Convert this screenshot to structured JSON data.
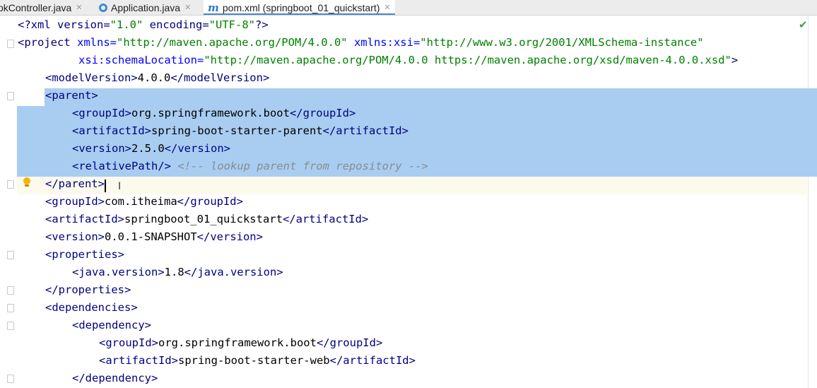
{
  "tabs": [
    {
      "label": "okController.java",
      "icon": "java-icon",
      "active": false
    },
    {
      "label": "Application.java",
      "icon": "java-icon",
      "active": false
    },
    {
      "label": "pom.xml (springboot_01_quickstart)",
      "icon": "maven-icon",
      "active": true
    }
  ],
  "editor": {
    "status_icon": "check-icon",
    "code": {
      "l1": {
        "a": "<?xml version=",
        "b": "\"1.0\"",
        "c": " encoding=",
        "d": "\"UTF-8\"",
        "e": "?>"
      },
      "l2": {
        "a": "<project ",
        "b": "xmlns=",
        "c": "\"http://maven.apache.org/POM/4.0.0\"",
        "d": " xmlns:xsi=",
        "e": "\"http://www.w3.org/2001/XMLSchema-instance\""
      },
      "l3": {
        "a": "xsi:schemaLocation=",
        "b": "\"http://maven.apache.org/POM/4.0.0 https://maven.apache.org/xsd/maven-4.0.0.xsd\"",
        "c": ">"
      },
      "l4": {
        "open": "<modelVersion>",
        "text": "4.0.0",
        "close": "</modelVersion>"
      },
      "l5": {
        "open": "<parent>"
      },
      "l6": {
        "open": "<groupId>",
        "text": "org.springframework.boot",
        "close": "</groupId>"
      },
      "l7": {
        "open": "<artifactId>",
        "text": "spring-boot-starter-parent",
        "close": "</artifactId>"
      },
      "l8": {
        "open": "<version>",
        "text": "2.5.0",
        "close": "</version>"
      },
      "l9": {
        "open": "<relativePath/>",
        "comment": "<!-- lookup parent from repository -->"
      },
      "l10": {
        "close": "</parent>"
      },
      "l11": {
        "open": "<groupId>",
        "text": "com.itheima",
        "close": "</groupId>"
      },
      "l12": {
        "open": "<artifactId>",
        "text": "springboot_01_quickstart",
        "close": "</artifactId>"
      },
      "l13": {
        "open": "<version>",
        "text": "0.0.1-SNAPSHOT",
        "close": "</version>"
      },
      "l14": {
        "open": "<properties>"
      },
      "l15": {
        "open": "<java.version>",
        "text": "1.8",
        "close": "</java.version>"
      },
      "l16": {
        "close": "</properties>"
      },
      "l17": {
        "open": "<dependencies>"
      },
      "l18": {
        "open": "<dependency>"
      },
      "l19": {
        "open": "<groupId>",
        "text": "org.springframework.boot",
        "close": "</groupId>"
      },
      "l20": {
        "open": "<artifactId>",
        "text": "spring-boot-starter-web",
        "close": "</artifactId>"
      },
      "l21": {
        "close": "</dependency>"
      }
    }
  },
  "colors": {
    "tag": "#000080",
    "attribute": "#0000ff",
    "string": "#008000",
    "comment": "#8c8c8c",
    "selection": "#a8cdf1",
    "caret_row": "#fcfaed",
    "tab_accent": "#4a88c7"
  }
}
